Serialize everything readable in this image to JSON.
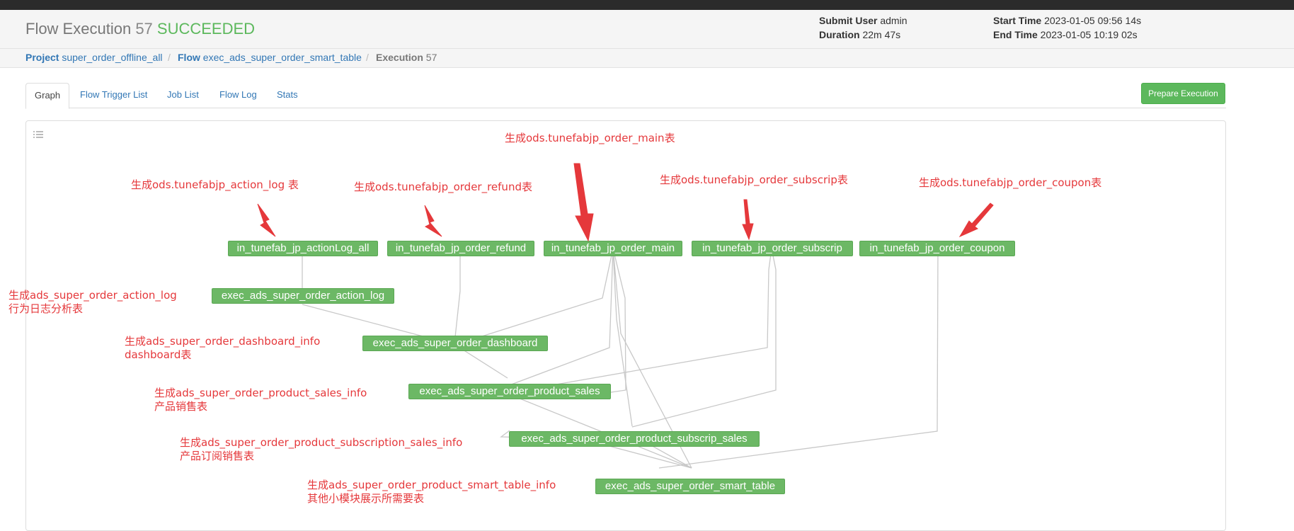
{
  "header": {
    "title_prefix": "Flow Execution",
    "exec_id": "57",
    "status": "SUCCEEDED",
    "submit_user_label": "Submit User",
    "submit_user": "admin",
    "duration_label": "Duration",
    "duration": "22m 47s",
    "start_time_label": "Start Time",
    "start_time": "2023-01-05 09:56 14s",
    "end_time_label": "End Time",
    "end_time": "2023-01-05 10:19 02s"
  },
  "breadcrumb": {
    "project_label": "Project",
    "project": "super_order_offline_all",
    "flow_label": "Flow",
    "flow": "exec_ads_super_order_smart_table",
    "execution_label": "Execution",
    "execution": "57",
    "separator": "/"
  },
  "tabs": [
    "Graph",
    "Flow Trigger List",
    "Job List",
    "Flow Log",
    "Stats"
  ],
  "prepare_button": "Prepare Execution",
  "nodes": [
    "in_tunefab_jp_actionLog_all",
    "in_tunefab_jp_order_refund",
    "in_tunefab_jp_order_main",
    "in_tunefab_jp_order_subscrip",
    "in_tunefab_jp_order_coupon",
    "exec_ads_super_order_action_log",
    "exec_ads_super_order_dashboard",
    "exec_ads_super_order_product_sales",
    "exec_ads_super_order_product_subscrip_sales",
    "exec_ads_super_order_smart_table"
  ],
  "annotations": {
    "order_main": "生成ods.tunefabjp_order_main表",
    "action_log": "生成ods.tunefabjp_action_log 表",
    "order_refund": "生成ods.tunefabjp_order_refund表",
    "order_subscrip": "生成ods.tunefabjp_order_subscrip表",
    "order_coupon": "生成ods.tunefabjp_order_coupon表",
    "ads_action_log_1": "生成ads_super_order_action_log",
    "ads_action_log_2": "行为日志分析表",
    "ads_dashboard_1": "生成ads_super_order_dashboard_info",
    "ads_dashboard_2": "dashboard表",
    "ads_product_sales_1": "生成ads_super_order_product_sales_info",
    "ads_product_sales_2": "产品销售表",
    "ads_subscription_1": "生成ads_super_order_product_subscription_sales_info",
    "ads_subscription_2": "产品订阅销售表",
    "ads_smart_table_1": "生成ads_super_order_product_smart_table_info",
    "ads_smart_table_2": "其他小模块展示所需要表"
  },
  "colors": {
    "success": "#5cb85c",
    "node_fill": "#6cb865",
    "annotation": "#e5383b",
    "link": "#3277b5",
    "edge": "#c8c8c8"
  }
}
